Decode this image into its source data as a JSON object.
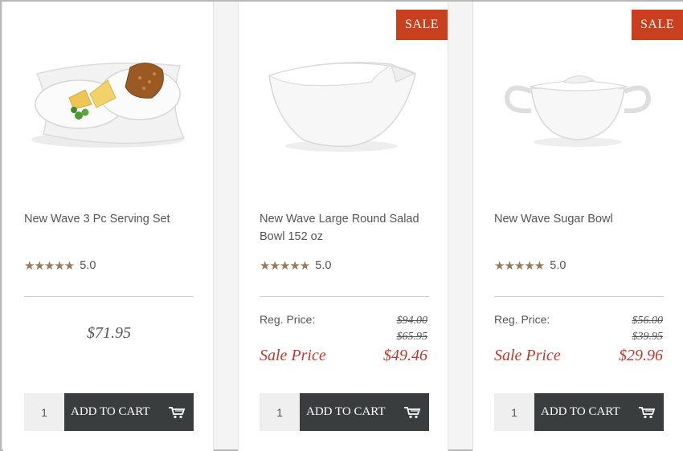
{
  "products": [
    {
      "title": "New Wave 3 Pc Serving Set",
      "rating_stars": "★★★★★",
      "rating_value": "5.0",
      "price": "$71.95",
      "quantity": "1",
      "add_to_cart_label": "ADD TO CART"
    },
    {
      "sale_badge": "SALE",
      "title": "New Wave Large Round Salad Bowl 152 oz",
      "rating_stars": "★★★★★",
      "rating_value": "5.0",
      "reg_label": "Reg. Price:",
      "reg_prices": [
        "$94.00",
        "$65.95"
      ],
      "sale_label": "Sale Price",
      "sale_price": "$49.46",
      "quantity": "1",
      "add_to_cart_label": "ADD TO CART"
    },
    {
      "sale_badge": "SALE",
      "title": "New Wave Sugar Bowl",
      "rating_stars": "★★★★★",
      "rating_value": "5.0",
      "reg_label": "Reg. Price:",
      "reg_prices": [
        "$56.00",
        "$39.95"
      ],
      "sale_label": "Sale Price",
      "sale_price": "$29.96",
      "quantity": "1",
      "add_to_cart_label": "ADD TO CART"
    }
  ],
  "colors": {
    "sale_accent": "#c0392b",
    "badge_bg": "#c8401e",
    "button_bg": "#3a3d3e",
    "star_color": "#9a7a55"
  }
}
